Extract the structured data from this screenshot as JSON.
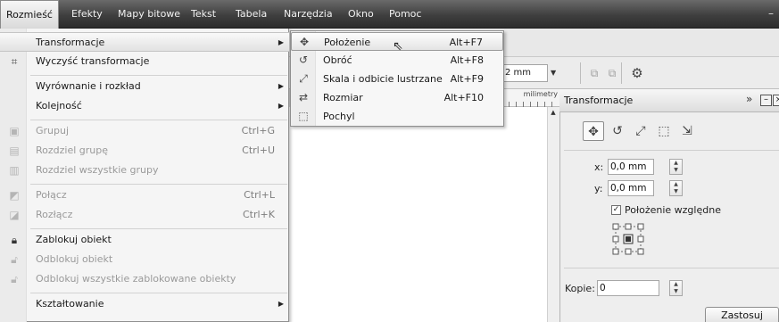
{
  "menubar": {
    "items": [
      {
        "label": "Rozmieść",
        "active": true
      },
      {
        "label": "Efekty"
      },
      {
        "label": "Mapy bitowe"
      },
      {
        "label": "Tekst"
      },
      {
        "label": "Tabela"
      },
      {
        "label": "Narzędzia"
      },
      {
        "label": "Okno"
      },
      {
        "label": "Pomoc"
      }
    ],
    "window_control": "–"
  },
  "menu": {
    "items": [
      {
        "label": "Transformacje",
        "submenu": true,
        "highlighted": true
      },
      {
        "label": "Wyczyść transformacje",
        "icon": "clear-transform-icon"
      },
      {
        "label": "Wyrównanie i rozkład",
        "submenu": true
      },
      {
        "label": "Kolejność",
        "submenu": true
      },
      {
        "label": "Grupuj",
        "shortcut": "Ctrl+G",
        "disabled": true,
        "icon": "group-icon"
      },
      {
        "label": "Rozdziel grupę",
        "shortcut": "Ctrl+U",
        "disabled": true,
        "icon": "ungroup-icon"
      },
      {
        "label": "Rozdziel wszystkie grupy",
        "disabled": true,
        "icon": "ungroup-all-icon"
      },
      {
        "label": "Połącz",
        "shortcut": "Ctrl+L",
        "disabled": true,
        "icon": "combine-icon"
      },
      {
        "label": "Rozłącz",
        "shortcut": "Ctrl+K",
        "disabled": true,
        "icon": "break-apart-icon"
      },
      {
        "label": "Zablokuj obiekt",
        "icon": "lock-icon"
      },
      {
        "label": "Odblokuj obiekt",
        "disabled": true,
        "icon": "unlock-icon"
      },
      {
        "label": "Odblokuj wszystkie zablokowane obiekty",
        "disabled": true,
        "icon": "unlock-all-icon"
      },
      {
        "label": "Kształtowanie",
        "submenu": true
      }
    ]
  },
  "submenu": {
    "items": [
      {
        "label": "Położenie",
        "shortcut": "Alt+F7",
        "icon": "position-icon",
        "highlighted": true
      },
      {
        "label": "Obróć",
        "shortcut": "Alt+F8",
        "icon": "rotate-icon"
      },
      {
        "label": "Skala i odbicie lustrzane",
        "shortcut": "Alt+F9",
        "icon": "scale-mirror-icon"
      },
      {
        "label": "Rozmiar",
        "shortcut": "Alt+F10",
        "icon": "size-icon"
      },
      {
        "label": "Pochyl",
        "icon": "skew-icon"
      }
    ]
  },
  "propbar": {
    "unit_value": "2 mm"
  },
  "ruler": {
    "unit": "milimetry"
  },
  "docker": {
    "title": "Transformacje",
    "expand_symbol": "»",
    "x_label": "x:",
    "x_value": "0,0 mm",
    "y_label": "y:",
    "y_value": "0,0 mm",
    "relative_position_label": "Położenie względne",
    "relative_position_checked": true,
    "copies_label": "Kopie:",
    "copies_value": "0",
    "apply_label": "Zastosuj"
  }
}
